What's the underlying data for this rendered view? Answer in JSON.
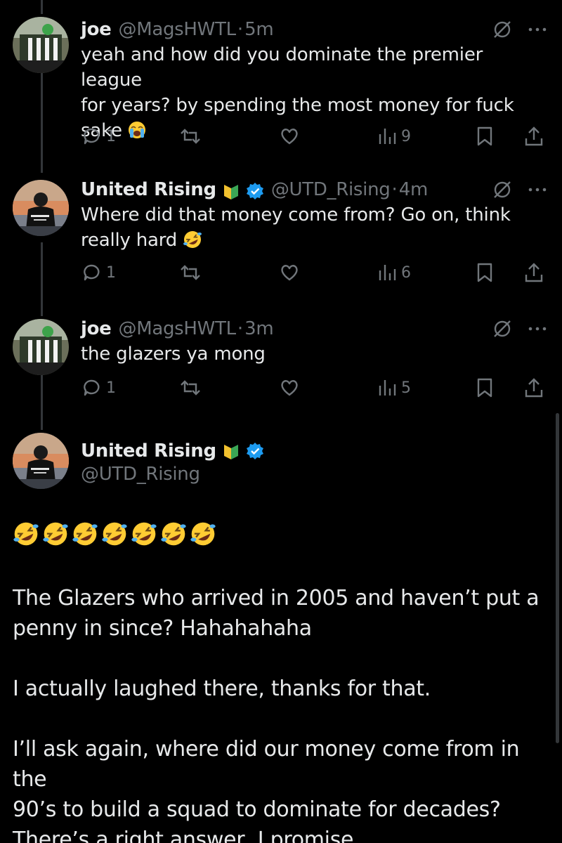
{
  "tweets": [
    {
      "name": "joe",
      "handle": "@MagsHWTL",
      "separator": "·",
      "time": "5m",
      "text_lines": [
        "yeah and how did you dominate the premier league",
        "for years? by spending the most money for fuck",
        "sake"
      ],
      "trailing_emoji": "loudly-crying-face",
      "replies": "1",
      "views": "9"
    },
    {
      "name": "United Rising",
      "handle": "@UTD_Rising",
      "separator": "·",
      "time": "4m",
      "text_lines": [
        "Where did that money come from? Go on, think",
        "really hard"
      ],
      "trailing_emoji": "rolling-on-floor-laughing",
      "replies": "1",
      "views": "6"
    },
    {
      "name": "joe",
      "handle": "@MagsHWTL",
      "separator": "·",
      "time": "3m",
      "text_lines": [
        "the glazers ya mong"
      ],
      "replies": "1",
      "views": "5"
    }
  ],
  "main_tweet": {
    "name": "United Rising",
    "handle": "@UTD_Rising",
    "emoji_count": 7,
    "paragraphs": [
      [
        "The Glazers who arrived in 2005 and haven’t put a",
        "penny in since? Hahahahaha"
      ],
      [
        "I actually laughed there, thanks for that."
      ],
      [
        "I’ll ask again, where did our money come from in the",
        "90’s to build a squad to dominate for decades?",
        "There’s a right answer, I promise."
      ]
    ]
  },
  "colors": {
    "background": "#000000",
    "text": "#e7e9ea",
    "muted": "#71767b",
    "verified": "#1d9bf0",
    "thread_line": "#333639"
  }
}
